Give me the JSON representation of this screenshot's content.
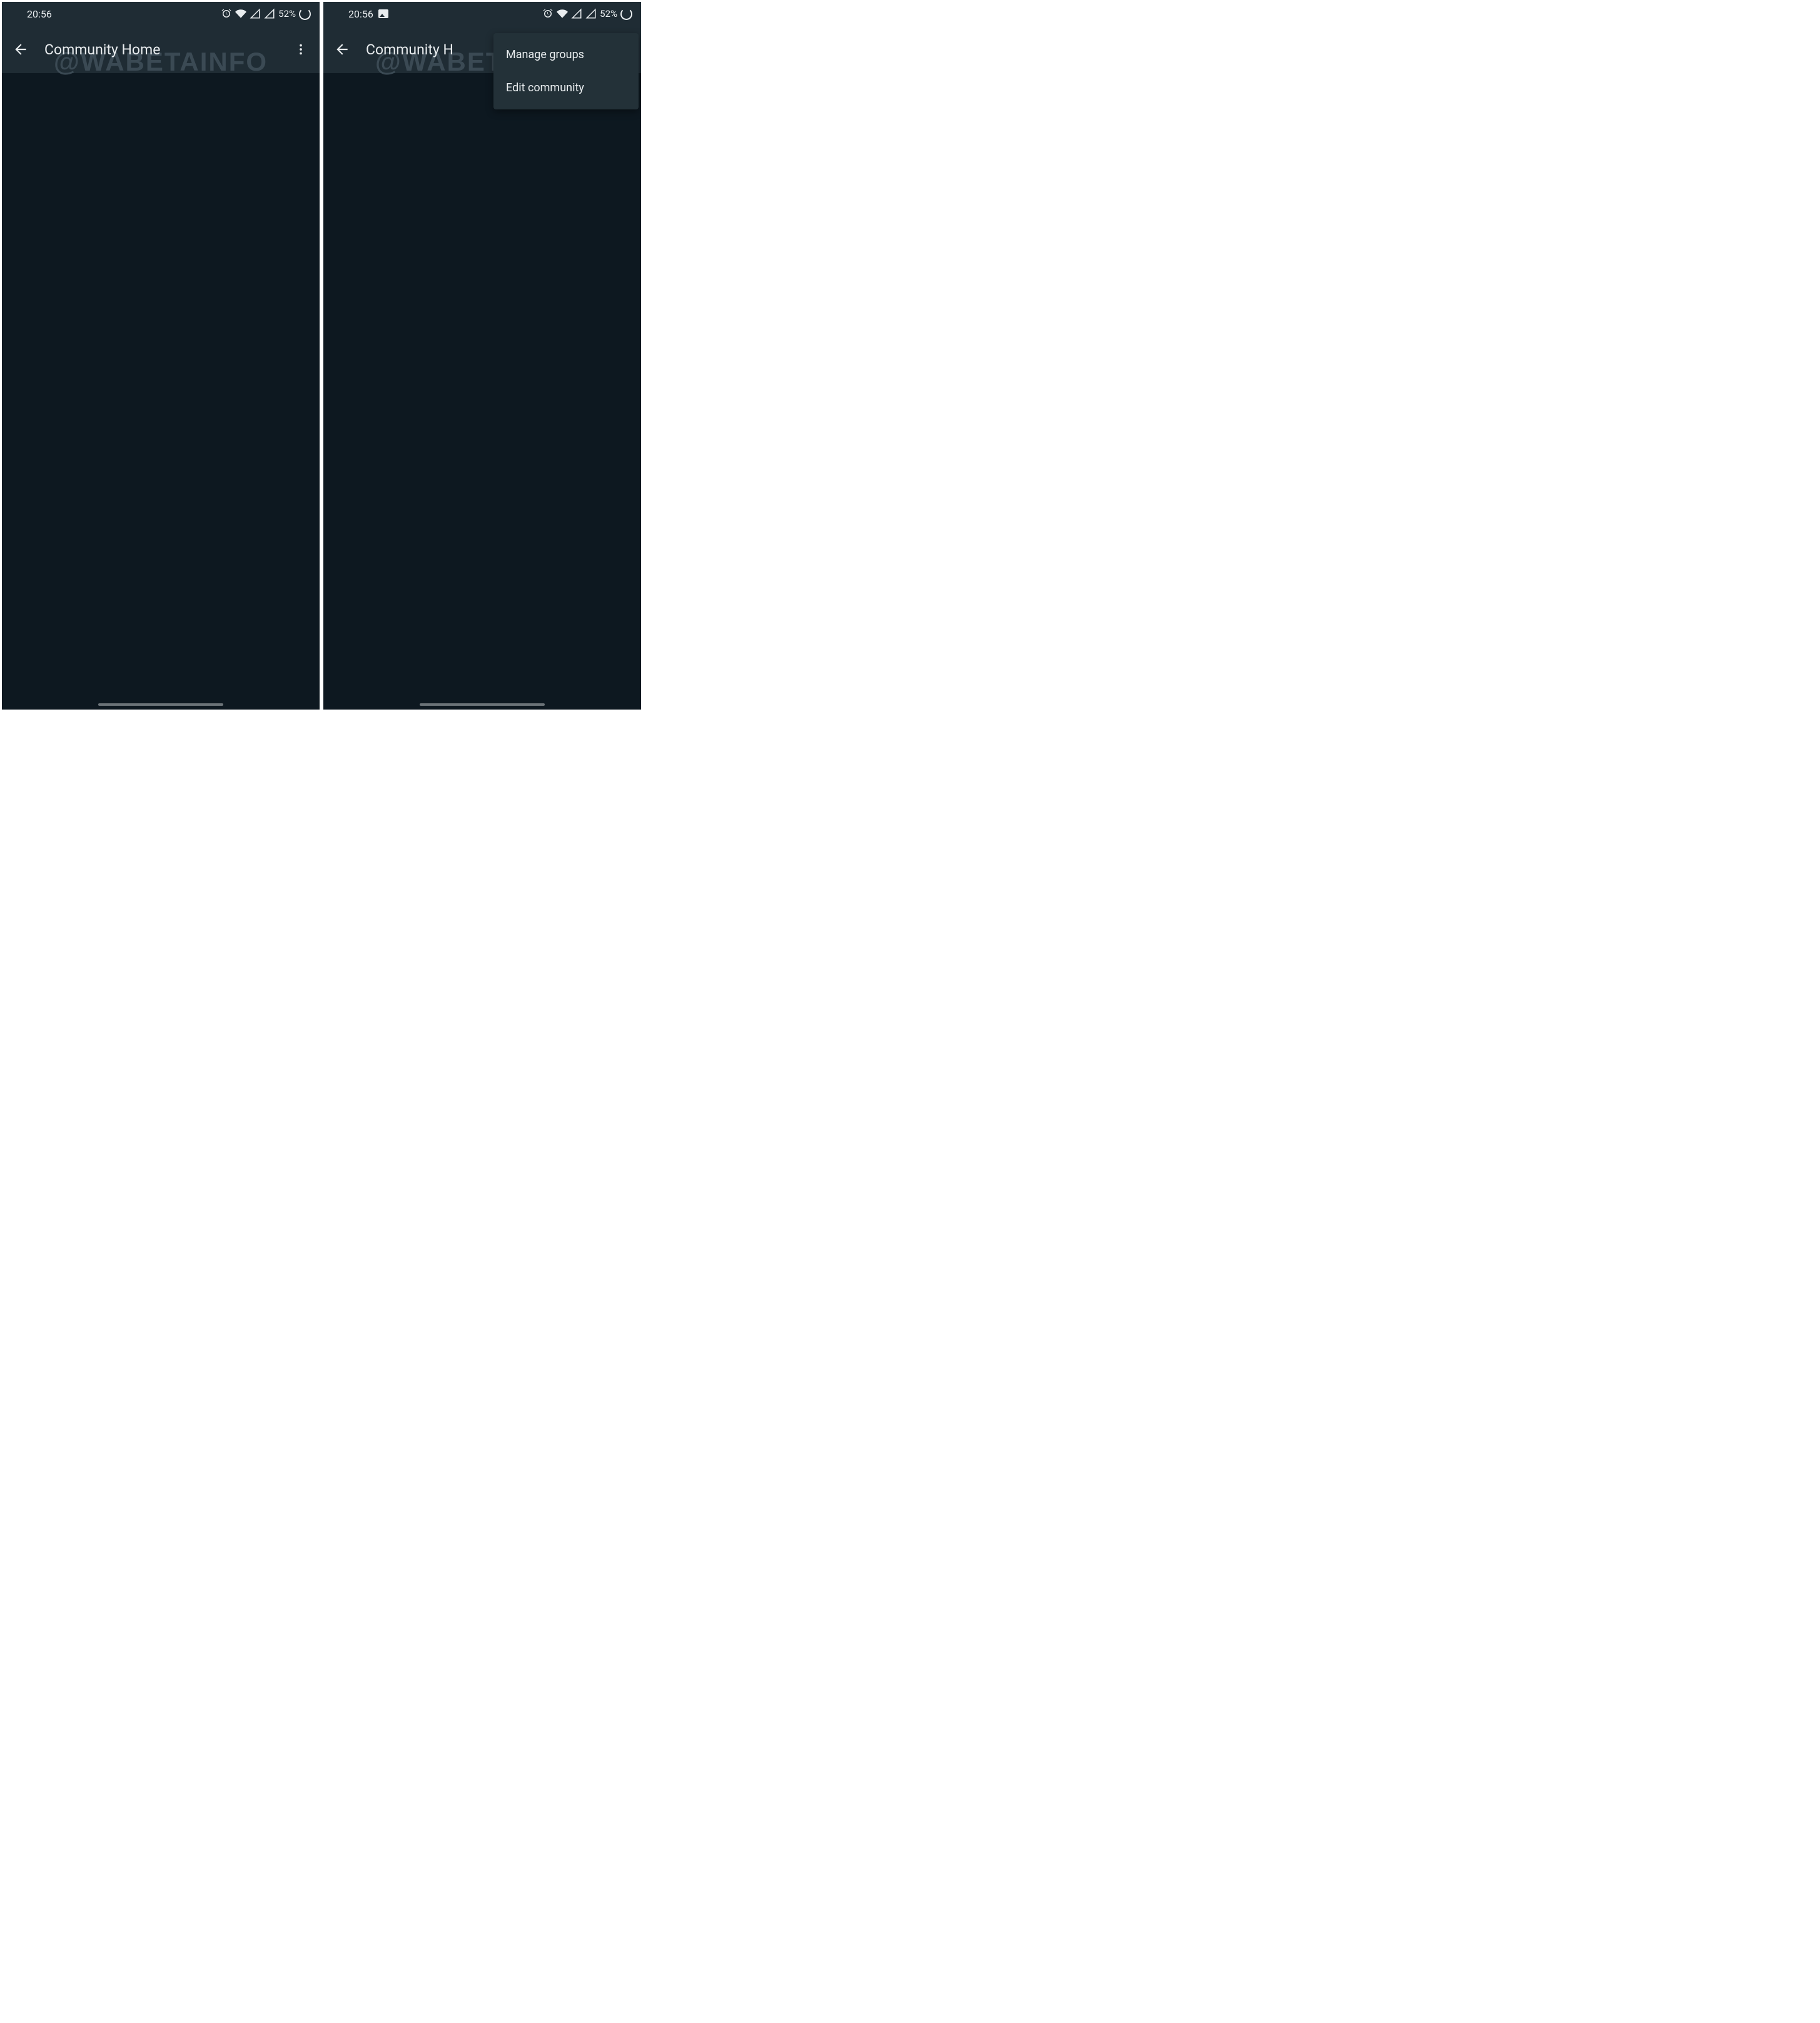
{
  "status": {
    "time": "20:56",
    "battery": "52%"
  },
  "app": {
    "title": "Community Home",
    "title_truncated": "Community H",
    "watermark": "@WABETAINFO"
  },
  "menu": {
    "items": [
      {
        "label": "Manage groups"
      },
      {
        "label": "Edit community"
      }
    ]
  }
}
